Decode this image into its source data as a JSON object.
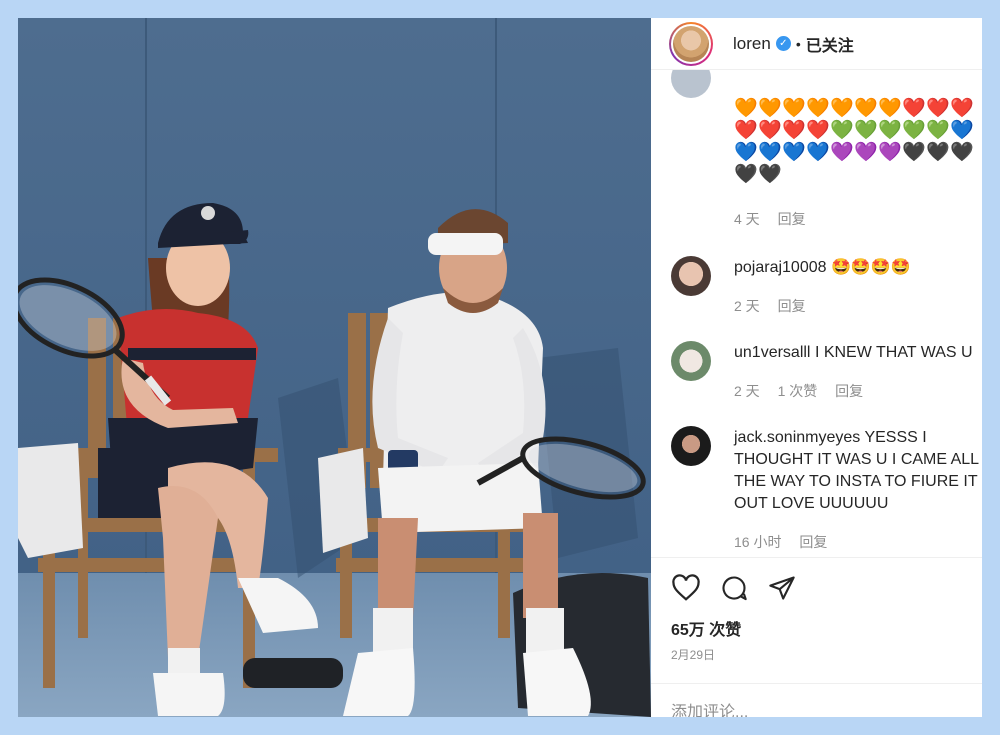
{
  "header": {
    "username": "loren",
    "follow_status": "已关注",
    "separator": "•"
  },
  "comments": [
    {
      "hearts": [
        "🧡",
        "🧡",
        "🧡",
        "🧡",
        "🧡",
        "🧡",
        "🧡",
        "❤️",
        "❤️",
        "❤️",
        "❤️",
        "❤️",
        "❤️",
        "❤️",
        "💚",
        "💚",
        "💚",
        "💚",
        "💚",
        "💙",
        "💙",
        "💙",
        "💙",
        "💙",
        "💜",
        "💜",
        "💜",
        "🖤",
        "🖤",
        "🖤",
        "🖤",
        "🖤"
      ],
      "time": "4 天",
      "reply": "回复"
    },
    {
      "username": "pojaraj10008",
      "text": "🤩🤩🤩🤩",
      "time": "2 天",
      "reply": "回复"
    },
    {
      "username": "un1versalll",
      "text": "I KNEW THAT WAS U",
      "time": "2 天",
      "likes": "1 次赞",
      "reply": "回复"
    },
    {
      "username": "jack.soninmyeyes",
      "text": "YESSS I THOUGHT IT WAS U I CAME ALL THE WAY TO INSTA TO FIURE IT OUT LOVE UUUUUU",
      "time": "16 小时",
      "reply": "回复"
    }
  ],
  "actions": {
    "like_icon": "heart-icon",
    "comment_icon": "comment-icon",
    "share_icon": "share-icon"
  },
  "likes": "65万 次赞",
  "date": "2月29日",
  "add_comment_placeholder": "添加评论..."
}
